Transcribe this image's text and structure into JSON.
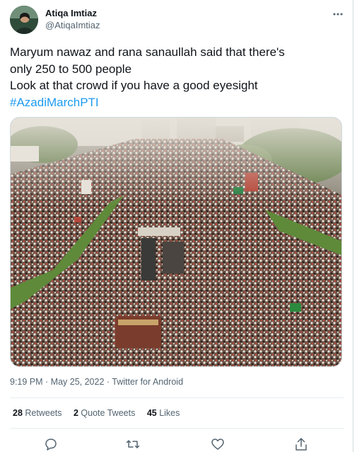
{
  "tweet": {
    "author": {
      "display_name": "Atiqa Imtiaz",
      "handle": "@AtiqaImtiaz",
      "avatar_icon": "avatar-photo"
    },
    "more_icon": "more-horizontal-icon",
    "text_lines": [
      "Maryum nawaz and rana sanaullah said that there's",
      "only 250 to 500 people",
      "Look at that crowd if you have a good eyesight"
    ],
    "hashtag": "#AzadiMarchPTI",
    "timestamp": "9:19 PM · May 25, 2022",
    "separator": " · ",
    "source": "Twitter for Android",
    "stats": {
      "retweets_count": "28",
      "retweets_label": "Retweets",
      "quote_count": "2",
      "quote_label": "Quote Tweets",
      "likes_count": "45",
      "likes_label": "Likes"
    },
    "actions": [
      "reply-icon",
      "retweet-icon",
      "like-icon",
      "share-icon"
    ]
  },
  "colors": {
    "text": "#0f1419",
    "secondary": "#536471",
    "link": "#1d9bf0",
    "border": "#cfd9de"
  }
}
